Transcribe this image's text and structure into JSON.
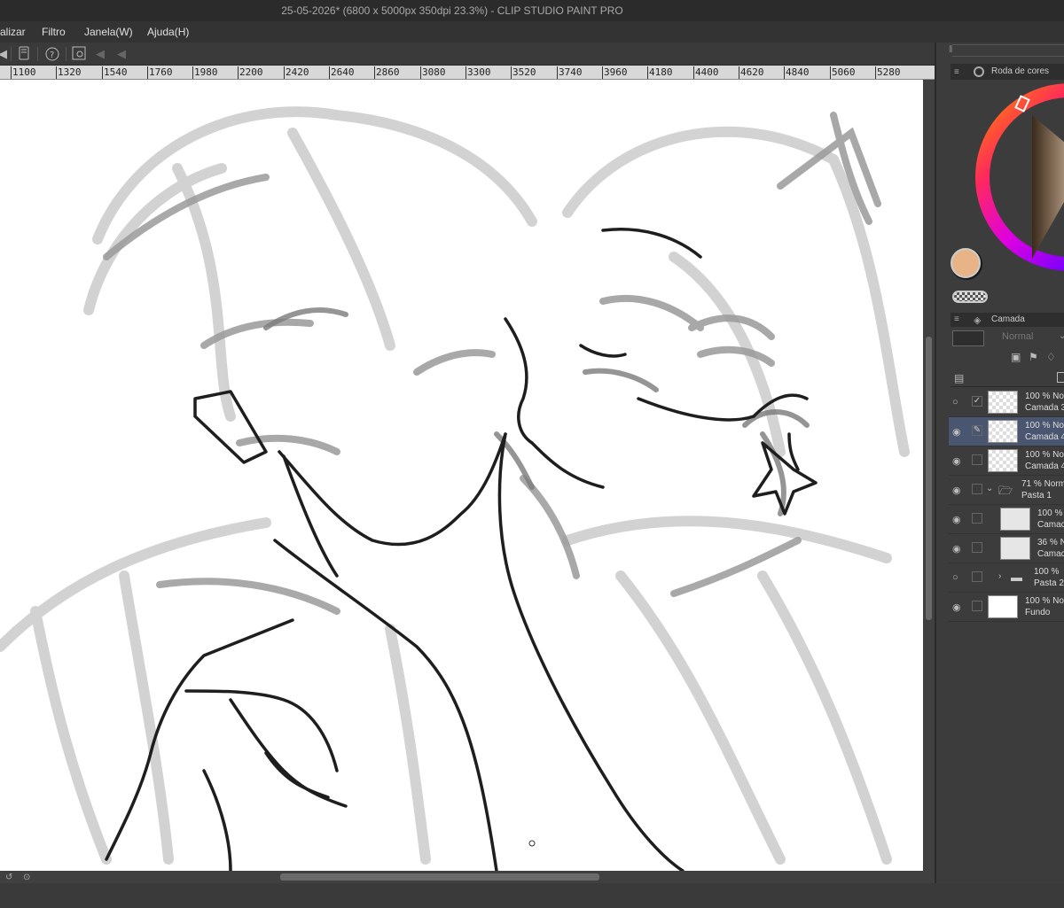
{
  "title_bar": {
    "text": "25-05-2026* (6800 x 5000px 350dpi 23.3%)  - CLIP STUDIO PAINT PRO"
  },
  "menu": {
    "items": [
      {
        "label": "alizar"
      },
      {
        "label": "Filtro"
      },
      {
        "label": "Janela(W)"
      },
      {
        "label": "Ajuda(H)"
      }
    ]
  },
  "toolbar": {
    "icons": [
      "tool-arrow-icon",
      "device-icon",
      "help-icon",
      "navigator-icon",
      "previous-icon",
      "back-icon"
    ]
  },
  "ruler": {
    "marks": [
      "1100",
      "1320",
      "1540",
      "1760",
      "1980",
      "2200",
      "2420",
      "2640",
      "2860",
      "3080",
      "3300",
      "3520",
      "3740",
      "3960",
      "4180",
      "4400",
      "4620",
      "4840",
      "5060",
      "5280"
    ]
  },
  "color_wheel": {
    "tab_label": "Roda de cores",
    "main_color": "#e8b487",
    "sub_color": "#1a1a1a"
  },
  "layers": {
    "tab_label": "Camada",
    "blend_mode": "Normal",
    "rows": [
      {
        "line1": "100 % No",
        "line2": "Camada 3",
        "visible": false,
        "indicator": "check",
        "selected": false,
        "indent": 0,
        "folder": false,
        "thumb": "transparent"
      },
      {
        "line1": "100 % No",
        "line2": "Camada 4",
        "visible": true,
        "indicator": "pen",
        "selected": true,
        "indent": 0,
        "folder": false,
        "thumb": "transparent"
      },
      {
        "line1": "100 % No",
        "line2": "Camada 4",
        "visible": true,
        "indicator": "",
        "selected": false,
        "indent": 0,
        "folder": false,
        "thumb": "transparent"
      },
      {
        "line1": "71 % Norm",
        "line2": "Pasta 1",
        "visible": true,
        "indicator": "",
        "selected": false,
        "indent": 0,
        "folder": true,
        "expanded": true,
        "thumb": "none"
      },
      {
        "line1": "100 %",
        "line2": "Camac",
        "visible": true,
        "indicator": "",
        "selected": false,
        "indent": 1,
        "folder": false,
        "thumb": "sketch"
      },
      {
        "line1": "36 % N",
        "line2": "Camac",
        "visible": true,
        "indicator": "",
        "selected": false,
        "indent": 1,
        "folder": false,
        "thumb": "sketch"
      },
      {
        "line1": "100 %",
        "line2": "Pasta 2",
        "visible": false,
        "indicator": "",
        "selected": false,
        "indent": 1,
        "folder": true,
        "expanded": false,
        "thumb": "none"
      },
      {
        "line1": "100 % No",
        "line2": "Fundo",
        "visible": true,
        "indicator": "",
        "selected": false,
        "indent": 0,
        "folder": false,
        "thumb": "white"
      }
    ]
  }
}
